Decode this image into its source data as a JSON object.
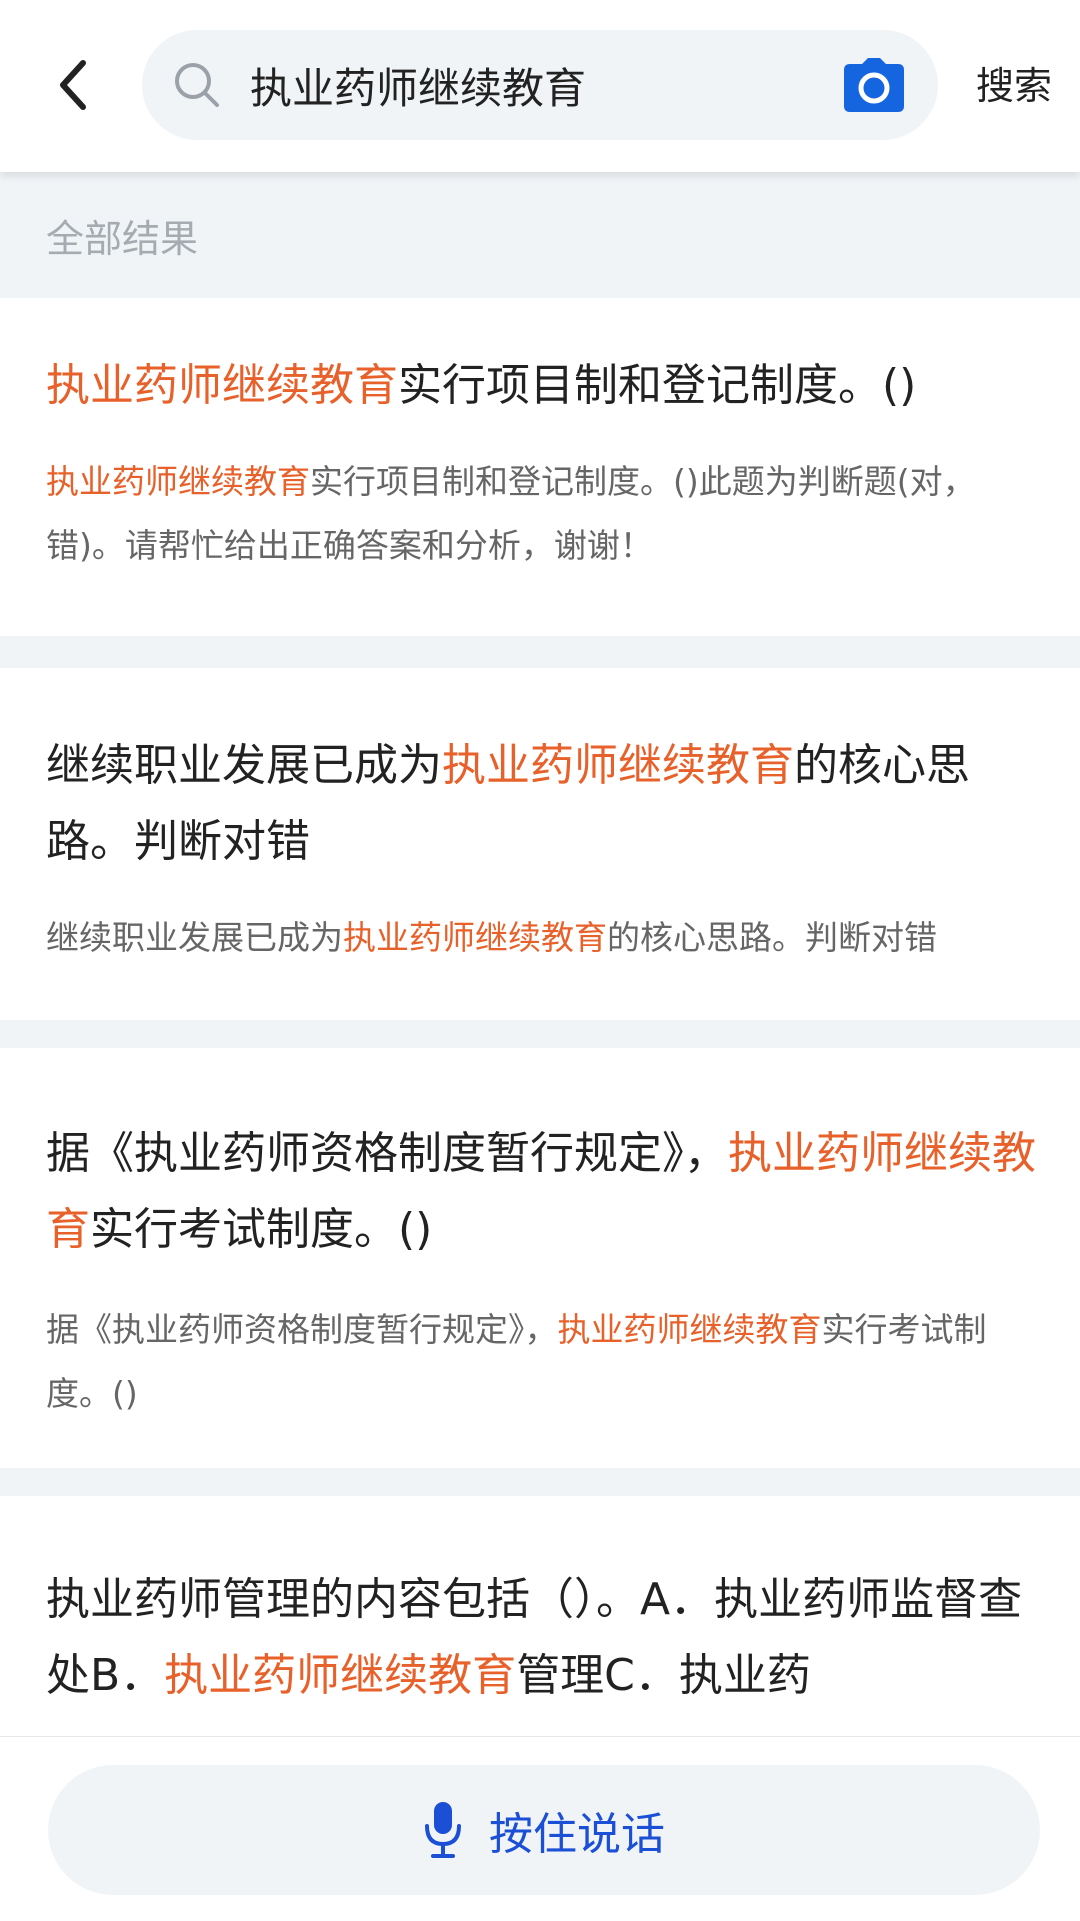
{
  "header": {
    "search_value": "执业药师继续教育",
    "search_button_label": "搜索"
  },
  "section_label": "全部结果",
  "results": [
    {
      "title_parts": [
        "",
        "执业药师继续教育",
        "实行项目制和登记制度。()"
      ],
      "desc_parts": [
        "",
        "执业药师继续教育",
        "实行项目制和登记制度。()此题为判断题(对，错)。请帮忙给出正确答案和分析，谢谢！"
      ]
    },
    {
      "title_parts": [
        "继续职业发展已成为",
        "执业药师继续教育",
        "的核心思路。判断对错"
      ],
      "desc_parts": [
        "继续职业发展已成为",
        "执业药师继续教育",
        "的核心思路。判断对错"
      ]
    },
    {
      "title_parts": [
        "据《执业药师资格制度暂行规定》，",
        "执业药师继续教育",
        "实行考试制度。()"
      ],
      "desc_parts": [
        "据《执业药师资格制度暂行规定》，",
        "执业药师继续教育",
        "实行考试制度。()"
      ]
    },
    {
      "title_parts": [
        "执业药师管理的内容包括（）。A．执业药师监督查处B．",
        "执业药师继续教育",
        "管理C．执业药"
      ]
    }
  ],
  "voice_button_label": "按住说话",
  "colors": {
    "highlight": "#e8602a",
    "accent_blue": "#1a4fd6",
    "camera_blue": "#1565e0",
    "cursor": "#e5386f"
  },
  "icons": {
    "back": "chevron-left-icon",
    "search": "magnifier-icon",
    "camera": "camera-icon",
    "mic": "microphone-icon"
  }
}
